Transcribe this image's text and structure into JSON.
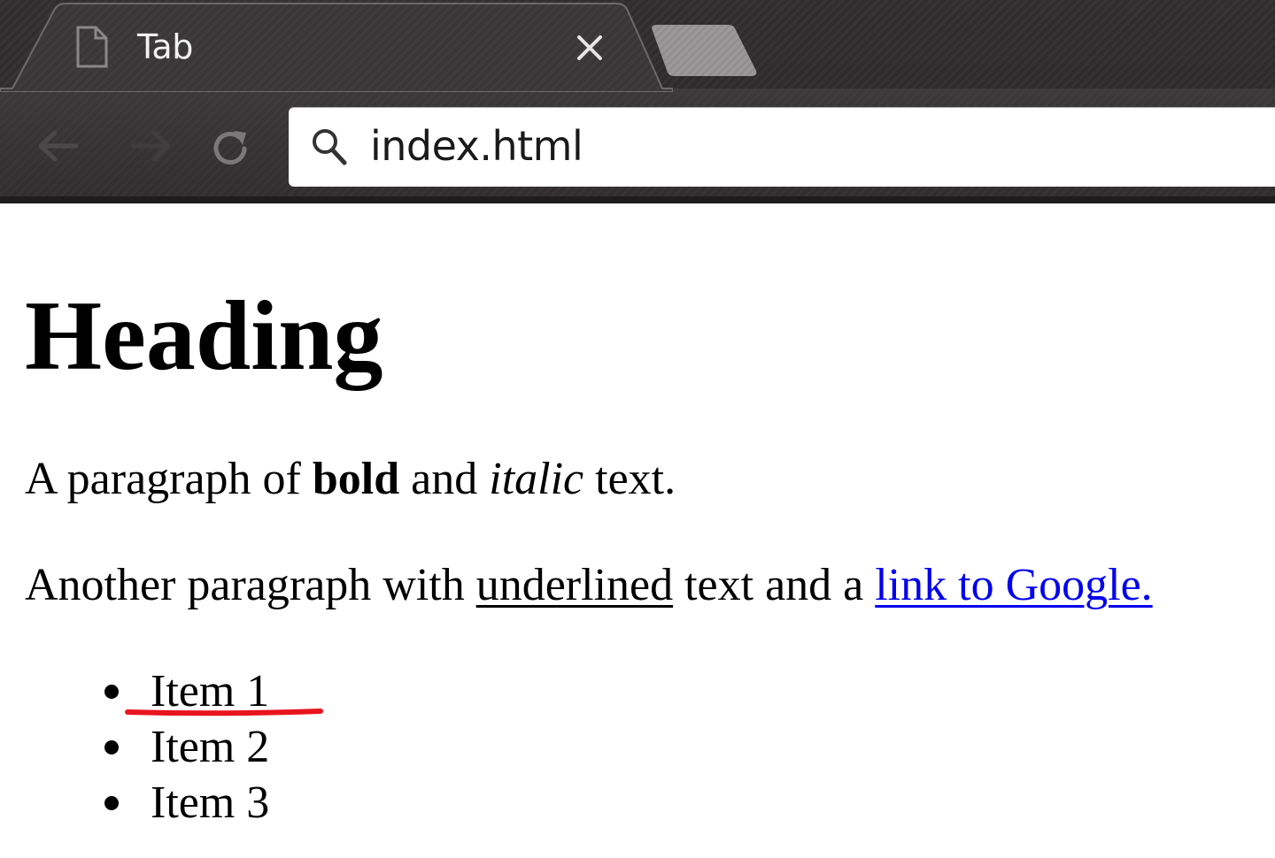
{
  "browser": {
    "tab": {
      "title": "Tab",
      "icon": "page-icon",
      "close_icon": "close-icon"
    },
    "new_tab_icon": "new-tab-icon",
    "nav": {
      "back_icon": "back-arrow-icon",
      "forward_icon": "forward-arrow-icon",
      "reload_icon": "reload-icon"
    },
    "address_bar": {
      "search_icon": "search-icon",
      "value": "index.html"
    },
    "colors": {
      "chrome_dark": "#2f2d2d",
      "tab_active": "#3a3838",
      "omnibox_bg": "#ffffff"
    }
  },
  "page": {
    "heading": "Heading",
    "paragraph1": {
      "before": "A paragraph of ",
      "bold": "bold",
      "middle": " and ",
      "italic": "italic",
      "after": " text."
    },
    "paragraph2": {
      "before": "Another paragraph with ",
      "underlined": "underlined",
      "middle": " text and a ",
      "link": "link to Google."
    },
    "list": [
      {
        "label": "Item 1"
      },
      {
        "label": "Item 2"
      },
      {
        "label": "Item 3"
      }
    ],
    "colors": {
      "link": "#0000ee",
      "annotation": "#e8141e"
    }
  }
}
